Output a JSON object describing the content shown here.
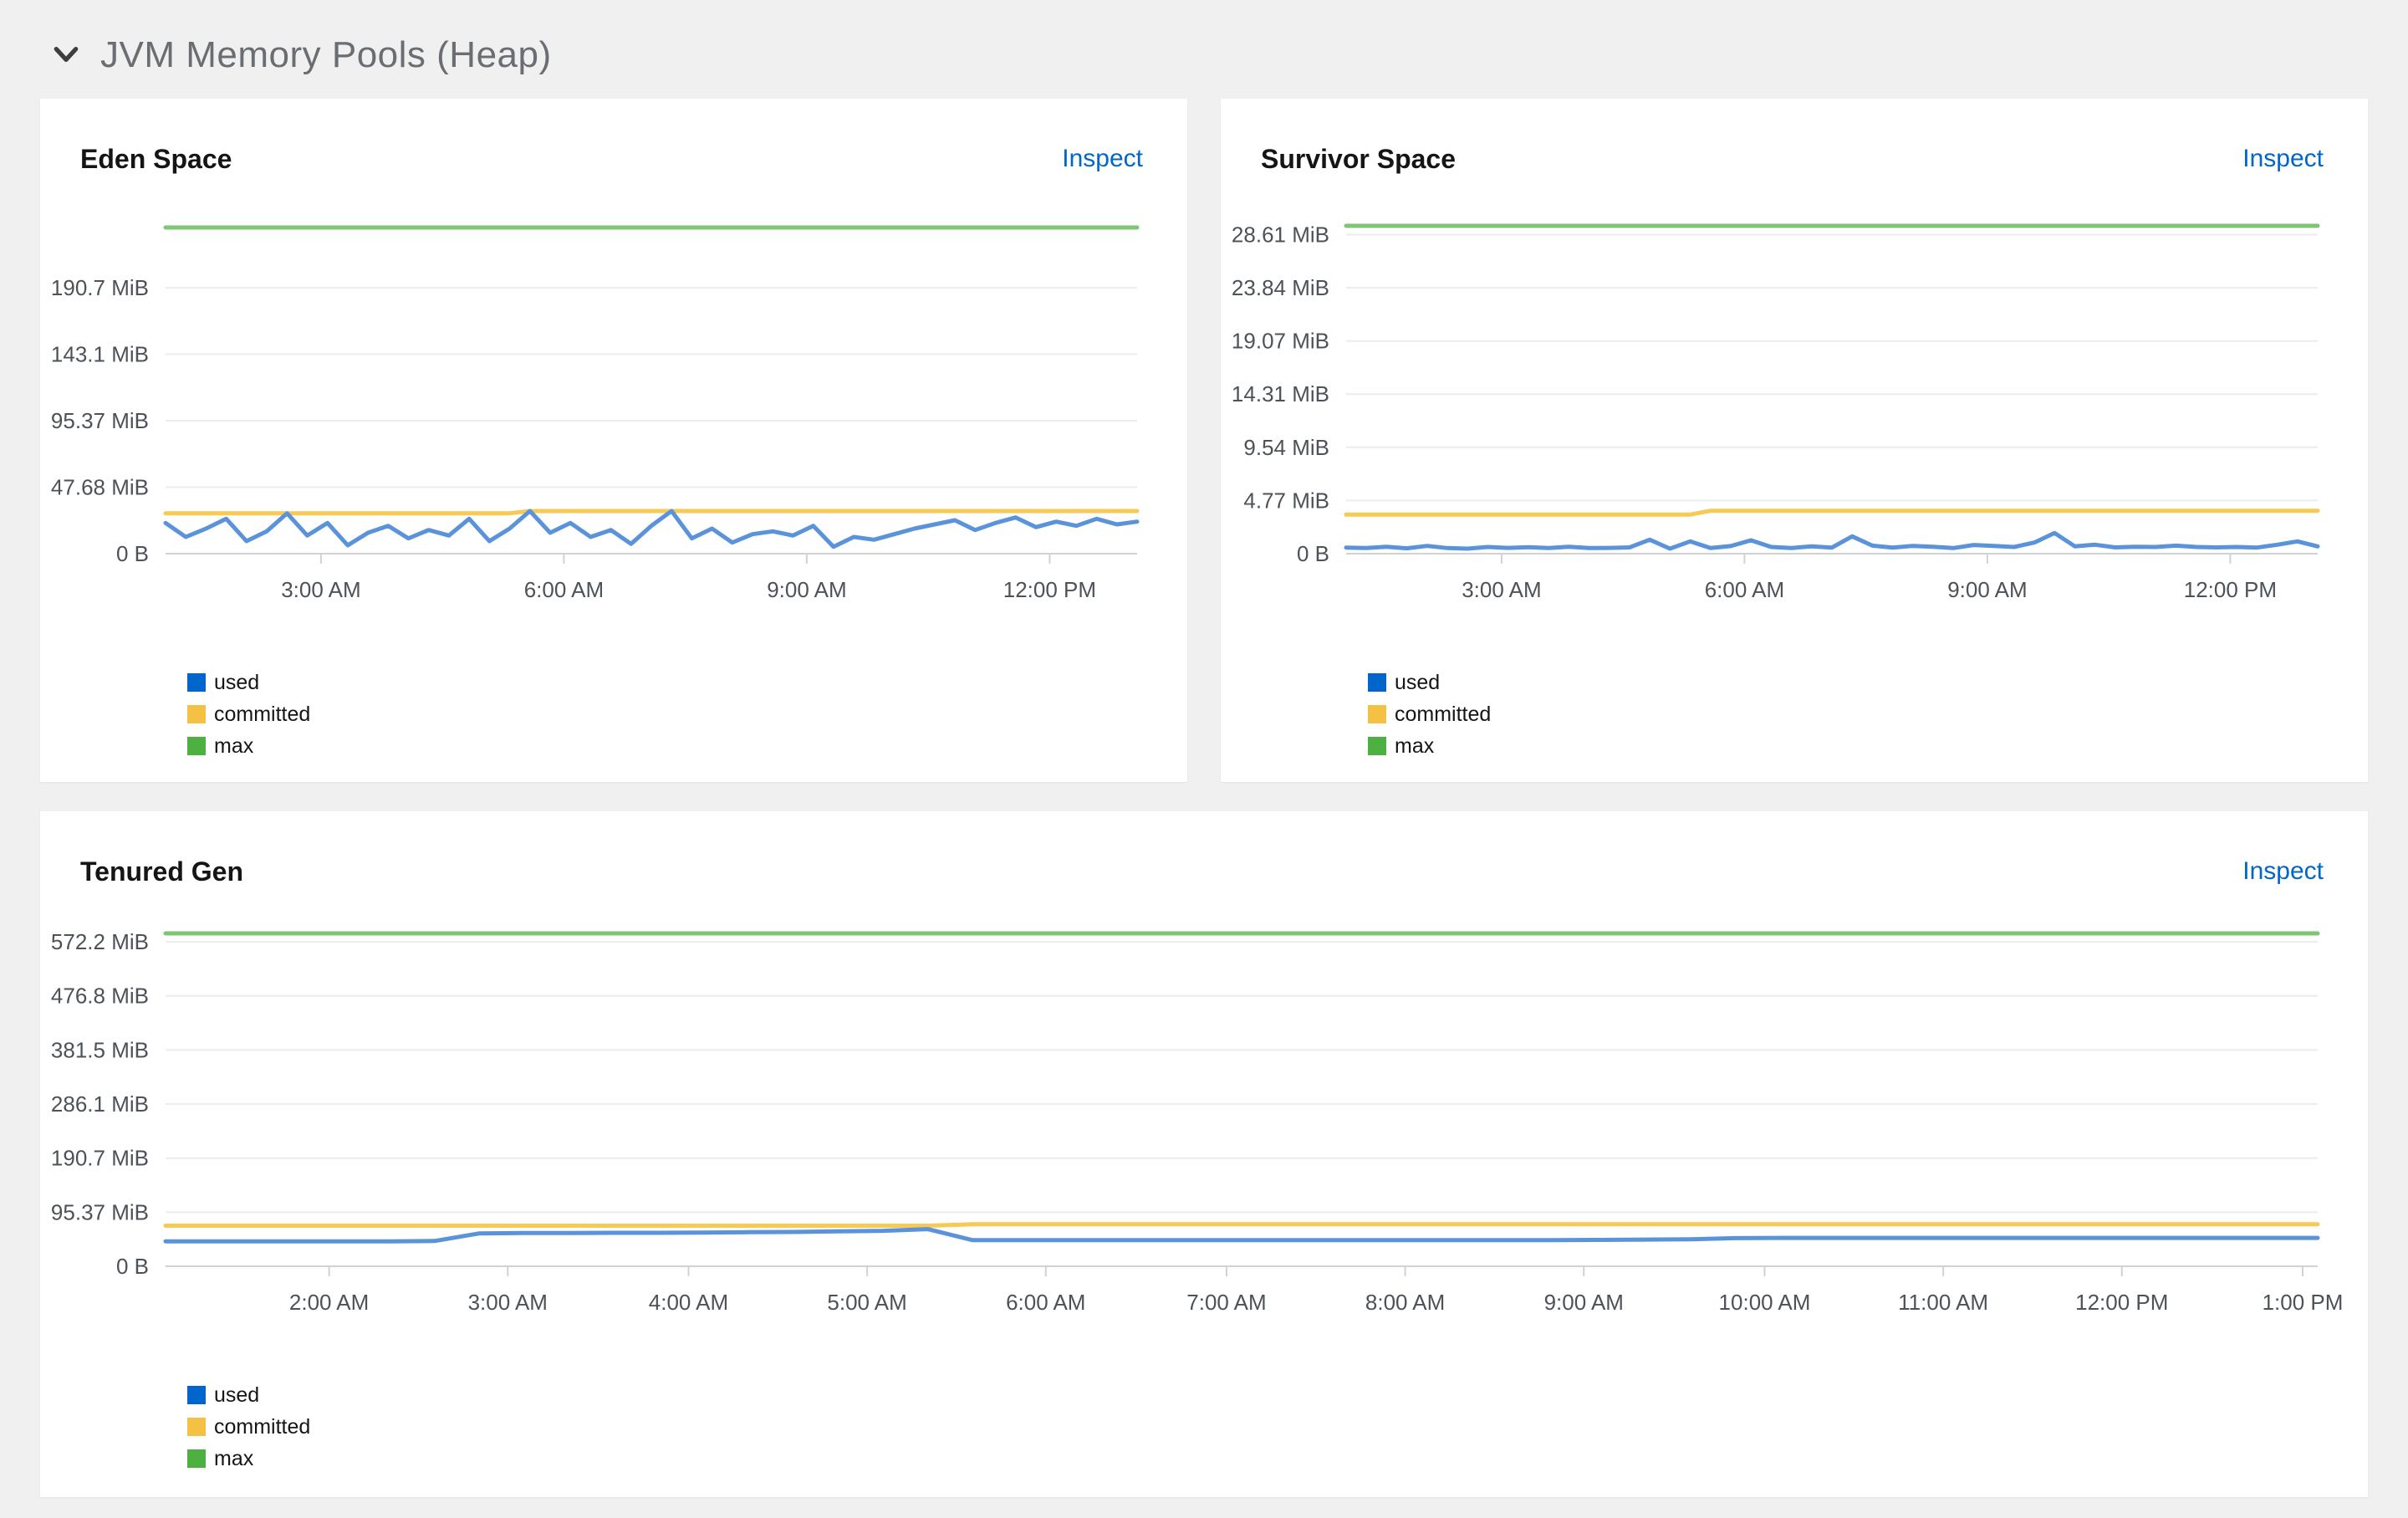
{
  "section": {
    "title": "JVM Memory Pools (Heap)",
    "icon": "chevron-down-icon",
    "expanded": true
  },
  "panels": [
    {
      "title": "Eden Space",
      "inspect_label": "Inspect"
    },
    {
      "title": "Survivor Space",
      "inspect_label": "Inspect"
    },
    {
      "title": "Tenured Gen",
      "inspect_label": "Inspect"
    }
  ],
  "colors": {
    "page_bg": "#f0f0f0",
    "panel_bg": "#ffffff",
    "link": "#0066cc",
    "grid": "#ececec",
    "baseline": "#d2d2d2",
    "axis_text": "#4d5258",
    "section_title": "#6a6e73",
    "used": "#0066cc",
    "committed": "#f4c145",
    "max": "#4cb140"
  },
  "chart_data": [
    {
      "type": "line",
      "title": "Eden Space",
      "ylabel_unit": "MiB",
      "ylim": [
        0,
        234
      ],
      "grid": true,
      "legend_position": "bottom-left",
      "yticks": [
        {
          "value": 0,
          "label": "0 B"
        },
        {
          "value": 47.68,
          "label": "47.68 MiB"
        },
        {
          "value": 95.37,
          "label": "95.37 MiB"
        },
        {
          "value": 143.1,
          "label": "143.1 MiB"
        },
        {
          "value": 190.7,
          "label": "190.7 MiB"
        }
      ],
      "xticks": [
        {
          "f": 0.16,
          "label": "3:00 AM"
        },
        {
          "f": 0.41,
          "label": "6:00 AM"
        },
        {
          "f": 0.66,
          "label": "9:00 AM"
        },
        {
          "f": 0.91,
          "label": "12:00 PM"
        }
      ],
      "series": [
        {
          "name": "max",
          "legend_color": "#4cb140",
          "line_color": "#7cc674",
          "values": [
            234,
            234
          ]
        },
        {
          "name": "committed",
          "legend_color": "#f4c145",
          "line_color": "#f6ca55",
          "values": [
            29,
            29,
            29,
            29,
            29,
            29,
            29,
            29,
            29,
            29,
            29,
            29,
            29,
            29,
            29,
            29,
            29,
            29,
            30.6,
            30.6,
            30.6,
            30.6,
            30.6,
            30.6,
            30.6,
            30.6,
            30.6,
            30.6,
            30.6,
            30.6,
            30.6,
            30.6,
            30.6,
            30.6,
            30.6,
            30.6,
            30.6,
            30.6,
            30.6,
            30.6,
            30.6,
            30.6,
            30.6,
            30.6,
            30.6,
            30.6,
            30.6,
            30.6,
            30.6
          ]
        },
        {
          "name": "used",
          "legend_color": "#0066cc",
          "line_color": "#5b93db",
          "values": [
            22,
            12,
            18,
            25,
            9,
            16,
            29,
            13,
            22,
            6,
            15,
            20,
            11,
            17,
            13,
            25,
            9,
            18,
            30.6,
            15,
            22,
            12,
            17,
            7,
            20,
            30.6,
            11,
            18,
            8,
            14,
            16,
            13,
            20,
            5,
            12,
            10,
            14,
            18,
            21,
            24,
            17,
            22,
            26,
            19,
            23,
            20,
            25,
            21,
            23
          ]
        }
      ]
    },
    {
      "type": "line",
      "title": "Survivor Space",
      "ylabel_unit": "MiB",
      "ylim": [
        0,
        29.4
      ],
      "grid": true,
      "legend_position": "bottom-left",
      "yticks": [
        {
          "value": 0,
          "label": "0 B"
        },
        {
          "value": 4.77,
          "label": "4.77 MiB"
        },
        {
          "value": 9.54,
          "label": "9.54 MiB"
        },
        {
          "value": 14.31,
          "label": "14.31 MiB"
        },
        {
          "value": 19.07,
          "label": "19.07 MiB"
        },
        {
          "value": 23.84,
          "label": "23.84 MiB"
        },
        {
          "value": 28.61,
          "label": "28.61 MiB"
        }
      ],
      "xticks": [
        {
          "f": 0.16,
          "label": "3:00 AM"
        },
        {
          "f": 0.41,
          "label": "6:00 AM"
        },
        {
          "f": 0.66,
          "label": "9:00 AM"
        },
        {
          "f": 0.91,
          "label": "12:00 PM"
        }
      ],
      "series": [
        {
          "name": "max",
          "legend_color": "#4cb140",
          "line_color": "#7cc674",
          "values": [
            29.4,
            29.4
          ]
        },
        {
          "name": "committed",
          "legend_color": "#f4c145",
          "line_color": "#f6ca55",
          "values": [
            3.5,
            3.5,
            3.5,
            3.5,
            3.5,
            3.5,
            3.5,
            3.5,
            3.5,
            3.5,
            3.5,
            3.5,
            3.5,
            3.5,
            3.5,
            3.5,
            3.5,
            3.5,
            3.85,
            3.85,
            3.85,
            3.85,
            3.85,
            3.85,
            3.85,
            3.85,
            3.85,
            3.85,
            3.85,
            3.85,
            3.85,
            3.85,
            3.85,
            3.85,
            3.85,
            3.85,
            3.85,
            3.85,
            3.85,
            3.85,
            3.85,
            3.85,
            3.85,
            3.85,
            3.85,
            3.85,
            3.85,
            3.85,
            3.85
          ]
        },
        {
          "name": "used",
          "legend_color": "#0066cc",
          "line_color": "#5b93db",
          "values": [
            0.55,
            0.5,
            0.62,
            0.48,
            0.7,
            0.5,
            0.45,
            0.6,
            0.52,
            0.58,
            0.5,
            0.62,
            0.5,
            0.52,
            0.56,
            1.25,
            0.45,
            1.1,
            0.5,
            0.68,
            1.2,
            0.6,
            0.5,
            0.66,
            0.55,
            1.55,
            0.72,
            0.55,
            0.7,
            0.62,
            0.5,
            0.78,
            0.7,
            0.6,
            1.0,
            1.85,
            0.66,
            0.8,
            0.56,
            0.62,
            0.6,
            0.72,
            0.6,
            0.56,
            0.6,
            0.55,
            0.8,
            1.1,
            0.65
          ]
        }
      ]
    },
    {
      "type": "line",
      "title": "Tenured Gen",
      "ylabel_unit": "MiB",
      "ylim": [
        0,
        587
      ],
      "grid": true,
      "legend_position": "bottom-left",
      "yticks": [
        {
          "value": 0,
          "label": "0 B"
        },
        {
          "value": 95.37,
          "label": "95.37 MiB"
        },
        {
          "value": 190.7,
          "label": "190.7 MiB"
        },
        {
          "value": 286.1,
          "label": "286.1 MiB"
        },
        {
          "value": 381.5,
          "label": "381.5 MiB"
        },
        {
          "value": 476.8,
          "label": "476.8 MiB"
        },
        {
          "value": 572.2,
          "label": "572.2 MiB"
        }
      ],
      "xticks": [
        {
          "f": 0.076,
          "label": "2:00 AM"
        },
        {
          "f": 0.159,
          "label": "3:00 AM"
        },
        {
          "f": 0.243,
          "label": "4:00 AM"
        },
        {
          "f": 0.326,
          "label": "5:00 AM"
        },
        {
          "f": 0.409,
          "label": "6:00 AM"
        },
        {
          "f": 0.493,
          "label": "7:00 AM"
        },
        {
          "f": 0.576,
          "label": "8:00 AM"
        },
        {
          "f": 0.659,
          "label": "9:00 AM"
        },
        {
          "f": 0.743,
          "label": "10:00 AM"
        },
        {
          "f": 0.826,
          "label": "11:00 AM"
        },
        {
          "f": 0.909,
          "label": "12:00 PM"
        },
        {
          "f": 0.993,
          "label": "1:00 PM"
        }
      ],
      "series": [
        {
          "name": "max",
          "legend_color": "#4cb140",
          "line_color": "#7cc674",
          "values": [
            587,
            587
          ]
        },
        {
          "name": "committed",
          "legend_color": "#f4c145",
          "line_color": "#f6ca55",
          "values": [
            71.5,
            71.5,
            71.5,
            71.5,
            71.5,
            71.5,
            71.5,
            71.5,
            71.5,
            71.5,
            71.5,
            71.5,
            71.5,
            71.5,
            71.5,
            71.5,
            71.5,
            71.5,
            74,
            74,
            74,
            74,
            74,
            74,
            74,
            74,
            74,
            74,
            74,
            74,
            74,
            74,
            74,
            74,
            74,
            74,
            74,
            74,
            74,
            74,
            74,
            74,
            74,
            74,
            74,
            74,
            74,
            74,
            74
          ]
        },
        {
          "name": "used",
          "legend_color": "#0066cc",
          "line_color": "#5b93db",
          "values": [
            44,
            44,
            44,
            44,
            44,
            44,
            44.5,
            58,
            58.5,
            58.5,
            59,
            59,
            59.5,
            60,
            60.5,
            61.5,
            62.5,
            65.5,
            46,
            46,
            46,
            46,
            46,
            46,
            46,
            46,
            46,
            46,
            46,
            46,
            46,
            46,
            46.5,
            47,
            47.5,
            49.5,
            50,
            50,
            50,
            50,
            50,
            50,
            50,
            50,
            50,
            50,
            50,
            50,
            50
          ]
        }
      ]
    }
  ]
}
